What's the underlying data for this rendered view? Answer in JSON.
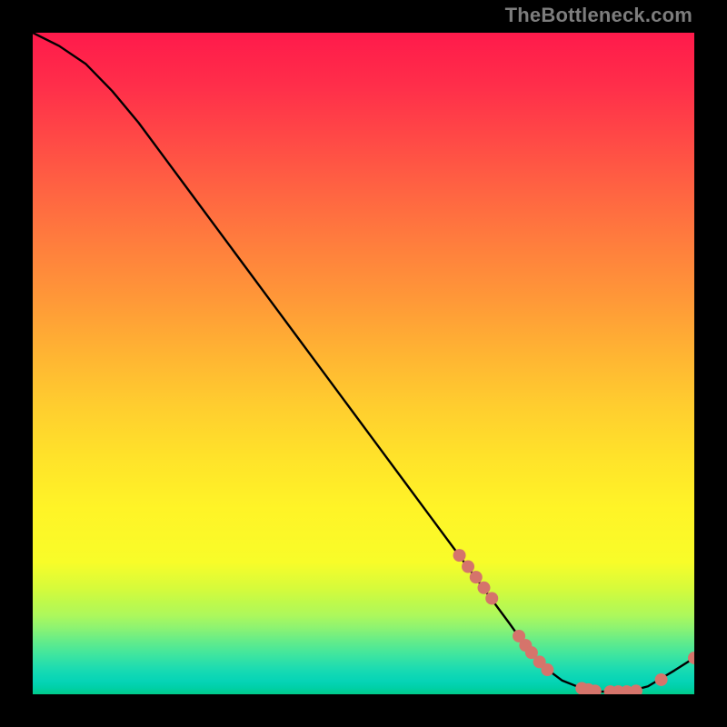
{
  "watermark": "TheBottleneck.com",
  "chart_data": {
    "type": "line",
    "title": "",
    "xlabel": "",
    "ylabel": "",
    "xlim": [
      0,
      100
    ],
    "ylim": [
      0,
      100
    ],
    "grid": false,
    "curve": {
      "comment": "Black curve approximated from pixels; values are estimated y (percent of plot height, 100=top, 0=bottom) at x (percent width).",
      "x": [
        0,
        4,
        8,
        12,
        16,
        20,
        24,
        28,
        32,
        36,
        40,
        44,
        48,
        52,
        56,
        60,
        64,
        68,
        72,
        75,
        78,
        80,
        83,
        86,
        90,
        93,
        95,
        97,
        100
      ],
      "y": [
        100,
        98.0,
        95.3,
        91.2,
        86.4,
        81.0,
        75.6,
        70.2,
        64.8,
        59.4,
        54.0,
        48.6,
        43.2,
        37.8,
        32.4,
        27.0,
        21.6,
        16.2,
        10.8,
        6.6,
        3.6,
        2.1,
        0.9,
        0.4,
        0.4,
        1.2,
        2.4,
        3.6,
        5.5
      ]
    },
    "markers": {
      "comment": "Salmon-colored dots along the lower right of the curve.",
      "color": "#d5746b",
      "points": [
        {
          "x": 64.5,
          "y": 21.0
        },
        {
          "x": 65.8,
          "y": 19.3
        },
        {
          "x": 67.0,
          "y": 17.7
        },
        {
          "x": 68.2,
          "y": 16.1
        },
        {
          "x": 69.4,
          "y": 14.5
        },
        {
          "x": 73.5,
          "y": 8.8
        },
        {
          "x": 74.5,
          "y": 7.4
        },
        {
          "x": 75.4,
          "y": 6.3
        },
        {
          "x": 76.6,
          "y": 4.9
        },
        {
          "x": 77.8,
          "y": 3.7
        },
        {
          "x": 83.0,
          "y": 0.9
        },
        {
          "x": 84.0,
          "y": 0.7
        },
        {
          "x": 85.0,
          "y": 0.5
        },
        {
          "x": 87.3,
          "y": 0.4
        },
        {
          "x": 88.5,
          "y": 0.4
        },
        {
          "x": 89.8,
          "y": 0.4
        },
        {
          "x": 91.2,
          "y": 0.5
        },
        {
          "x": 95.0,
          "y": 2.2
        },
        {
          "x": 100.0,
          "y": 5.5
        }
      ]
    }
  }
}
